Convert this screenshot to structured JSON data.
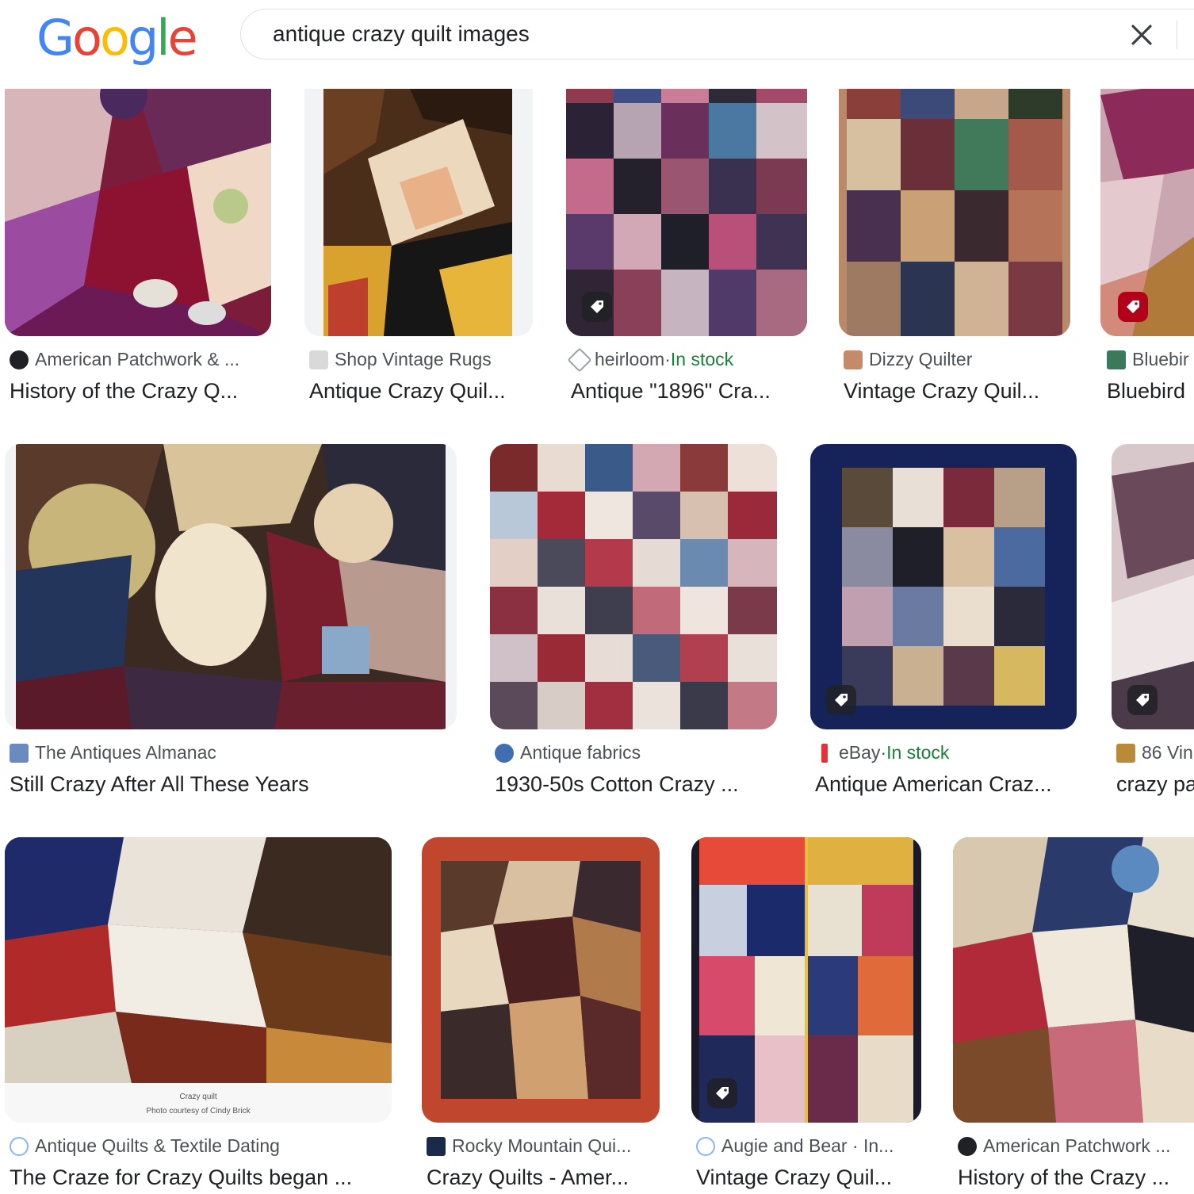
{
  "search": {
    "query": "antique crazy quilt images",
    "logo": "Google"
  },
  "colors": {
    "blue": "#4285F4",
    "red": "#EA4335",
    "yellow": "#FBBC05",
    "green": "#34A853",
    "in_stock": "#188038"
  },
  "row1": [
    {
      "source": "American Patchwork & ...",
      "title": "History of the Crazy Q..."
    },
    {
      "source": "Shop Vintage Rugs",
      "title": "Antique Crazy Quil..."
    },
    {
      "source": "heirloom",
      "sep": " · ",
      "stock": "In stock",
      "title": "Antique \"1896\" Cra..."
    },
    {
      "source": "Dizzy Quilter",
      "title": "Vintage Crazy Quil..."
    },
    {
      "source": "Bluebir",
      "title": "Bluebird"
    }
  ],
  "row2": [
    {
      "source": "The Antiques Almanac",
      "title": "Still Crazy After All These Years"
    },
    {
      "source": "Antique fabrics",
      "title": "1930-50s Cotton Crazy ..."
    },
    {
      "source": "eBay",
      "sep": " · ",
      "stock": "In stock",
      "title": "Antique American Craz..."
    },
    {
      "source": "86 Vin",
      "title": "crazy pa"
    }
  ],
  "row3": [
    {
      "source": "Antique Quilts & Textile Dating",
      "title": "The Craze for Crazy Quilts began ...",
      "caption1": "Crazy quilt",
      "caption2": "Photo courtesy of Cindy Brick"
    },
    {
      "source": "Rocky Mountain Qui...",
      "title": "Crazy Quilts - Amer..."
    },
    {
      "source": "Augie and Bear · In...",
      "title": "Vintage Crazy Quil..."
    },
    {
      "source": "American Patchwork ...",
      "title": "History of the Crazy ..."
    }
  ]
}
